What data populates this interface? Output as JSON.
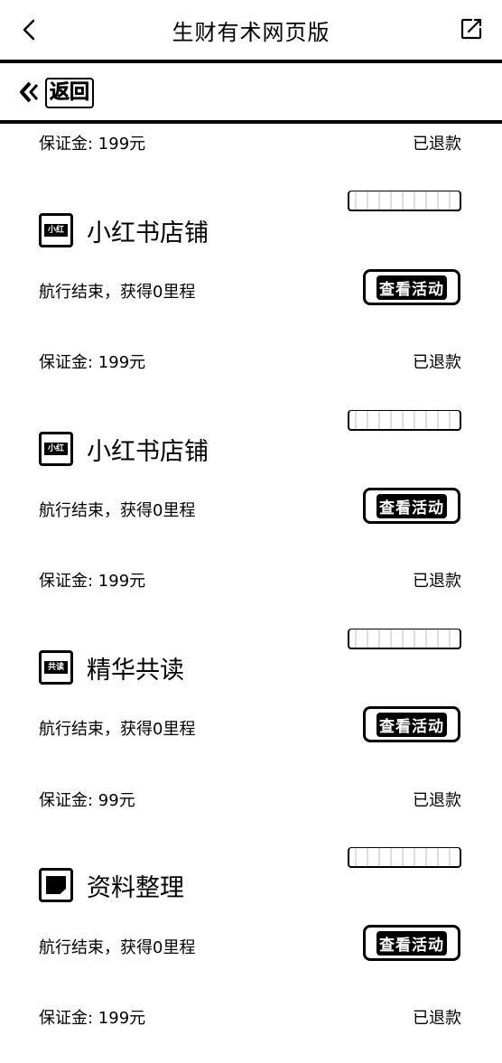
{
  "appbar": {
    "title": "生财有术网页版"
  },
  "backbar": {
    "label": "返回"
  },
  "top_item": {
    "deposit": "保证金: 199元",
    "status": "已退款"
  },
  "items": [
    {
      "stamp": "",
      "name": "小红书店铺",
      "result": "航行结束，获得0里程",
      "button": "查看活动",
      "deposit": "保证金: 199元",
      "status": "已退款",
      "icon": "xiaohongshu-icon"
    },
    {
      "stamp": "",
      "name": "小红书店铺",
      "result": "航行结束，获得0里程",
      "button": "查看活动",
      "deposit": "保证金: 199元",
      "status": "已退款",
      "icon": "xiaohongshu-icon"
    },
    {
      "stamp": "",
      "name": "精华共读",
      "result": "航行结束，获得0里程",
      "button": "查看活动",
      "deposit": "保证金: 99元",
      "status": "已退款",
      "icon": "reading-icon"
    },
    {
      "stamp": "",
      "name": "资料整理",
      "result": "航行结束，获得0里程",
      "button": "查看活动",
      "deposit": "保证金: 199元",
      "status": "已退款",
      "icon": "document-icon"
    }
  ]
}
